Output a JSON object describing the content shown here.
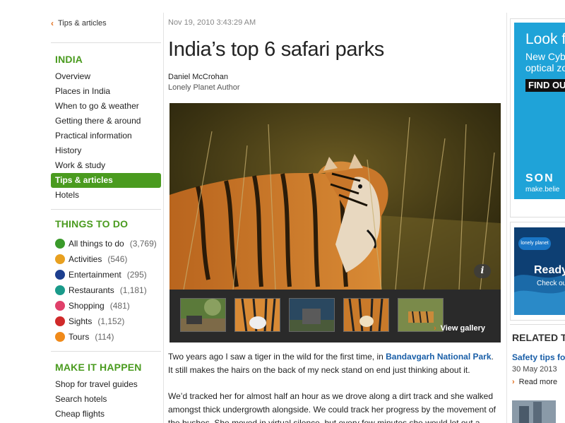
{
  "sidebar": {
    "back_link": "Tips & articles",
    "section1_heading": "INDIA",
    "section1_items": [
      {
        "label": "Overview",
        "active": false
      },
      {
        "label": "Places in India",
        "active": false
      },
      {
        "label": "When to go & weather",
        "active": false
      },
      {
        "label": "Getting there & around",
        "active": false
      },
      {
        "label": "Practical information",
        "active": false
      },
      {
        "label": "History",
        "active": false
      },
      {
        "label": "Work & study",
        "active": false
      },
      {
        "label": "Tips & articles",
        "active": true
      },
      {
        "label": "Hotels",
        "active": false
      }
    ],
    "section2_heading": "THINGS TO DO",
    "section2_items": [
      {
        "label": "All things to do",
        "count": "(3,769)",
        "icon": "checkmark-icon",
        "color": "#3a9a2a"
      },
      {
        "label": "Activities",
        "count": "(546)",
        "icon": "activities-icon",
        "color": "#e8a020"
      },
      {
        "label": "Entertainment",
        "count": "(295)",
        "icon": "star-icon",
        "color": "#1d3f8f"
      },
      {
        "label": "Restaurants",
        "count": "(1,181)",
        "icon": "cutlery-icon",
        "color": "#1a9a8a"
      },
      {
        "label": "Shopping",
        "count": "(481)",
        "icon": "shopping-bag-icon",
        "color": "#e0406a"
      },
      {
        "label": "Sights",
        "count": "(1,152)",
        "icon": "eye-icon",
        "color": "#d02a2a"
      },
      {
        "label": "Tours",
        "count": "(114)",
        "icon": "tours-icon",
        "color": "#f08a1a"
      }
    ],
    "section3_heading": "MAKE IT HAPPEN",
    "section3_items": [
      {
        "label": "Shop for travel guides"
      },
      {
        "label": "Search hotels"
      },
      {
        "label": "Cheap flights"
      }
    ]
  },
  "article": {
    "timestamp": "Nov 19, 2010 3:43:29 AM",
    "title": "India’s top 6 safari parks",
    "author": "Daniel McCrohan",
    "author_role": "Lonely Planet Author",
    "gallery": {
      "info_label": "i",
      "view_gallery_label": "View gallery",
      "thumbnail_count": 5
    },
    "para1_before": "Two years ago I saw a tiger in the wild for the first time, in ",
    "para1_link": "Bandavgarh National Park",
    "para1_after": ". It still makes the hairs on the back of my neck stand on end just thinking about it.",
    "para2": "We’d tracked her for almost half an hour as we drove along a dirt track and she walked amongst thick undergrowth alongside. We could track her progress by the movement of the bushes. She moved in virtual silence, but every few minutes she would let out a"
  },
  "right_column": {
    "ad1": {
      "headline": "Look fu",
      "line1": "New Cyb",
      "line2": "optical zo",
      "cta": "FIND OU",
      "brand": "SON",
      "tagline": "make.belie"
    },
    "ad2": {
      "logo": "lonely planet",
      "headline": "Ready",
      "subline": "Check ou"
    },
    "related_heading": "RELATED T",
    "related_link": "Safety tips fo",
    "related_date": "30 May 2013",
    "read_more": "Read more"
  },
  "colors": {
    "accent_green": "#4a9b1f",
    "link_blue": "#1a5fa8",
    "chevron_orange": "#e2701f"
  }
}
